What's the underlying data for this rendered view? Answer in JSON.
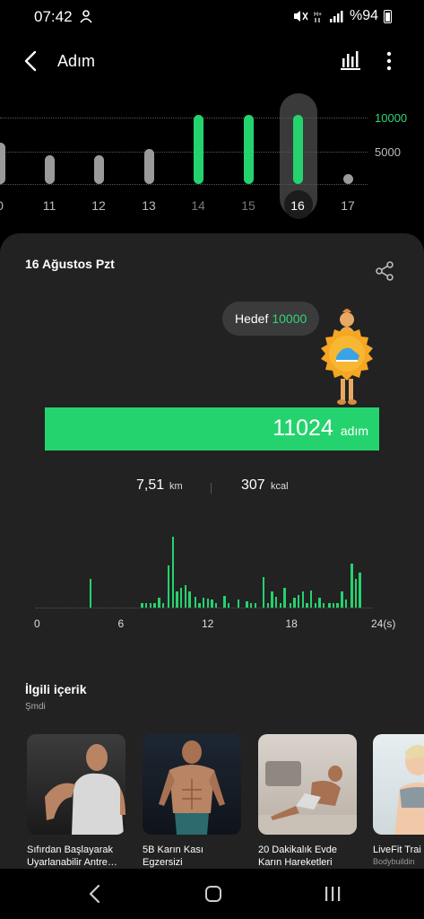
{
  "status_bar": {
    "time": "07:42",
    "battery": "%94",
    "icons": [
      "notification-icon",
      "mute-icon",
      "hplus-icon",
      "signal-icon",
      "battery-icon"
    ]
  },
  "header": {
    "title": "Adım",
    "icons": [
      "back-icon",
      "bar-chart-icon",
      "more-icon"
    ]
  },
  "day_chart": {
    "goal_label": "10000",
    "mid_label": "5000",
    "days": [
      {
        "label": "0",
        "steps": 6200
      },
      {
        "label": "11",
        "steps": 4300
      },
      {
        "label": "12",
        "steps": 4300
      },
      {
        "label": "13",
        "steps": 5300
      },
      {
        "label": "14",
        "steps": 11000
      },
      {
        "label": "15",
        "steps": 11000
      },
      {
        "label": "16",
        "steps": 11024
      },
      {
        "label": "17",
        "steps": 0
      }
    ],
    "selected_index": 6,
    "colors": {
      "goal_met": "#25d36e",
      "below_goal": "#9a9a9a",
      "goal_text": "#2dd573",
      "mid_text": "#bbbbbb"
    }
  },
  "detail": {
    "date": "16 Ağustos Pzt",
    "goal_prefix": "Hedef",
    "goal_value": "10000",
    "steps_value": "11024",
    "steps_unit": "adım",
    "distance_value": "7,51",
    "distance_unit": "km",
    "calories_value": "307",
    "calories_unit": "kcal"
  },
  "chart_data": {
    "type": "bar",
    "xlabel": "",
    "ylabel": "",
    "x_ticks": [
      "0",
      "6",
      "12",
      "18",
      "24(s)"
    ],
    "xlim": [
      0,
      24
    ],
    "ylim": [
      0,
      1000
    ],
    "x": [
      3.7,
      7.4,
      7.7,
      8.0,
      8.3,
      8.6,
      8.9,
      9.3,
      9.6,
      9.9,
      10.2,
      10.5,
      10.8,
      11.2,
      11.5,
      11.8,
      12.1,
      12.4,
      12.7,
      13.3,
      13.6,
      14.3,
      14.9,
      15.2,
      15.5,
      16.1,
      16.4,
      16.7,
      17.0,
      17.3,
      17.6,
      18.0,
      18.3,
      18.6,
      18.9,
      19.2,
      19.5,
      19.8,
      20.1,
      20.4,
      20.8,
      21.1,
      21.4,
      21.7,
      22.0,
      22.4,
      22.7,
      23.0
    ],
    "values": [
      360,
      60,
      60,
      60,
      60,
      120,
      60,
      520,
      880,
      200,
      250,
      280,
      200,
      130,
      60,
      120,
      110,
      100,
      60,
      140,
      60,
      100,
      80,
      60,
      60,
      380,
      60,
      200,
      130,
      60,
      240,
      60,
      120,
      160,
      200,
      60,
      210,
      60,
      120,
      60,
      60,
      60,
      60,
      200,
      100,
      550,
      360,
      430
    ]
  },
  "related": {
    "title": "İlgili içerik",
    "subtitle": "Şmdi",
    "items": [
      {
        "label": "Sıfırdan Başlayarak\nUyarlanabilir Antre…",
        "source": ""
      },
      {
        "label": "5B Karın Kası\nEgzersizi",
        "source": ""
      },
      {
        "label": "20 Dakikalık Evde\nKarın Hareketleri",
        "source": ""
      },
      {
        "label": "LiveFit Trai",
        "source": "Bodybuildin"
      }
    ]
  },
  "navbar": {
    "icons": [
      "nav-back-icon",
      "home-icon",
      "recent-apps-icon"
    ]
  }
}
